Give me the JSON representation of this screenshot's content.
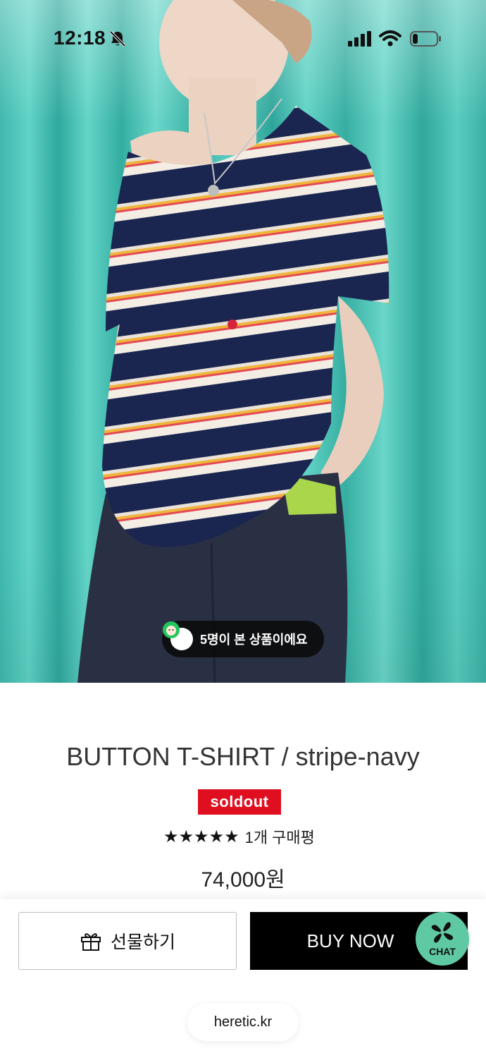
{
  "status_bar": {
    "time": "12:18"
  },
  "hero": {
    "viewers_text": "5명이 본 상품이에요"
  },
  "product": {
    "title": "BUTTON T-SHIRT / stripe-navy",
    "badge": "soldout",
    "stars": "★★★★★",
    "review_count": "1개 구매평",
    "price": "74,000원"
  },
  "actions": {
    "gift_label": "선물하기",
    "buy_label": "BUY NOW",
    "chat_label": "CHAT"
  },
  "footer": {
    "domain": "heretic.kr"
  },
  "colors": {
    "soldout": "#e00f1f",
    "buy_bg": "#000000",
    "chat_bg": "#5fc9a3",
    "curtain": "#3fb8ad"
  }
}
